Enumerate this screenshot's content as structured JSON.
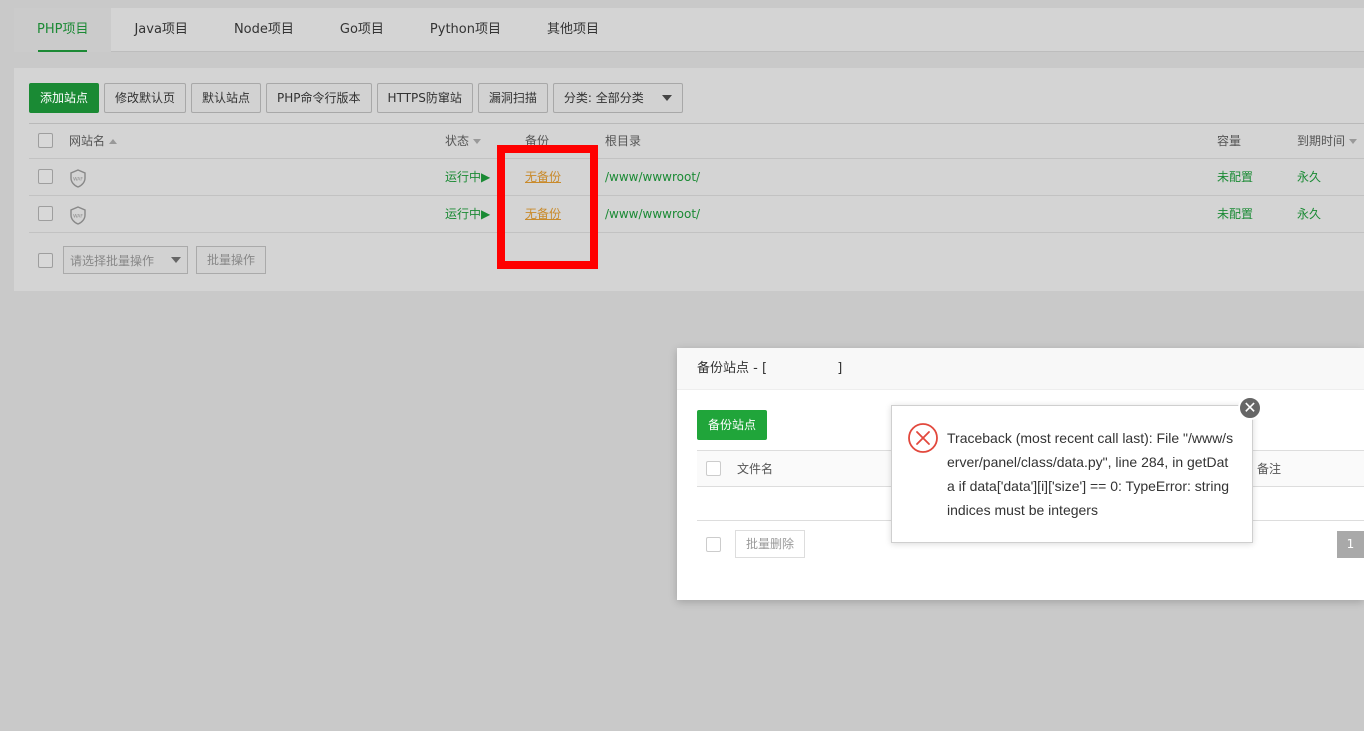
{
  "tabs": [
    {
      "label": "PHP项目",
      "active": true
    },
    {
      "label": "Java项目"
    },
    {
      "label": "Node项目"
    },
    {
      "label": "Go项目"
    },
    {
      "label": "Python项目"
    },
    {
      "label": "其他项目"
    }
  ],
  "toolbar": {
    "add_site": "添加站点",
    "edit_default_page": "修改默认页",
    "default_site": "默认站点",
    "php_cli_version": "PHP命令行版本",
    "https_protect": "HTTPS防窜站",
    "vuln_scan": "漏洞扫描",
    "category_select": "分类: 全部分类"
  },
  "table": {
    "headers": {
      "site_name": "网站名",
      "status": "状态",
      "backup": "备份",
      "root_dir": "根目录",
      "capacity": "容量",
      "expire": "到期时间"
    },
    "rows": [
      {
        "name": "",
        "waf_label": "WAF",
        "status": "运行中▶",
        "backup": "无备份",
        "root": "/www/wwwroot/",
        "capacity": "未配置",
        "expire": "永久"
      },
      {
        "name": "",
        "waf_label": "WAF",
        "status": "运行中▶",
        "backup": "无备份",
        "root": "/www/wwwroot/",
        "capacity": "未配置",
        "expire": "永久"
      }
    ]
  },
  "batch": {
    "select_placeholder": "请选择批量操作",
    "button": "批量操作"
  },
  "dialog": {
    "title": "备份站点 - [                 ]",
    "backup_button": "备份站点",
    "col_filename": "文件名",
    "col_note": "备注",
    "batch_delete": "批量删除",
    "page": "1"
  },
  "error": {
    "message": "Traceback (most recent call last): File \"/www/server/panel/class/data.py\", line 284, in getData if data['data'][i]['size'] == 0: TypeError: string indices must be integers",
    "close_symbol": "✕"
  },
  "colors": {
    "accent": "#1a8a34",
    "highlight": "#ff0000",
    "link_orange": "#c98a2a"
  }
}
